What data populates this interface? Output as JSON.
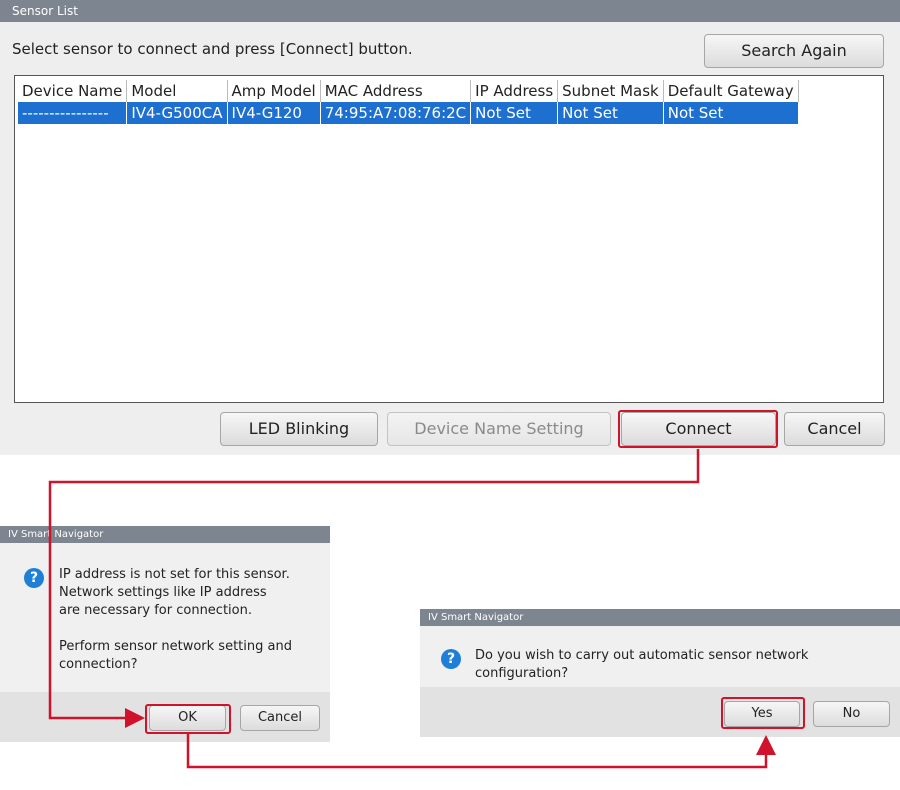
{
  "sensor_list": {
    "title": "Sensor List",
    "instruction": "Select sensor to connect and press [Connect] button.",
    "search_again": "Search Again",
    "columns": [
      "Device Name",
      "Model",
      "Amp Model",
      "MAC Address",
      "IP Address",
      "Subnet Mask",
      "Default Gateway"
    ],
    "rows": [
      [
        "----------------",
        "IV4-G500CA",
        "IV4-G120",
        "74:95:A7:08:76:2C",
        "Not Set",
        "Not Set",
        "Not Set"
      ]
    ],
    "buttons": {
      "led_blinking": "LED Blinking",
      "device_name_setting": "Device Name Setting",
      "connect": "Connect",
      "cancel": "Cancel"
    }
  },
  "dialog_ip_not_set": {
    "title": "IV Smart Navigator",
    "message_lines": [
      "IP address is not set for this sensor.",
      "Network settings like IP address",
      "are necessary for connection."
    ],
    "question_lines": [
      "Perform sensor network setting and",
      "connection?"
    ],
    "ok": "OK",
    "cancel": "Cancel"
  },
  "dialog_auto_config": {
    "title": "IV Smart Navigator",
    "message": "Do you wish to carry out automatic sensor network configuration?",
    "yes": "Yes",
    "no": "No"
  },
  "colors": {
    "selection": "#1d6fd0",
    "highlight": "#d0132b",
    "titlebar": "#7d8590"
  },
  "icons": [
    "question-icon"
  ]
}
